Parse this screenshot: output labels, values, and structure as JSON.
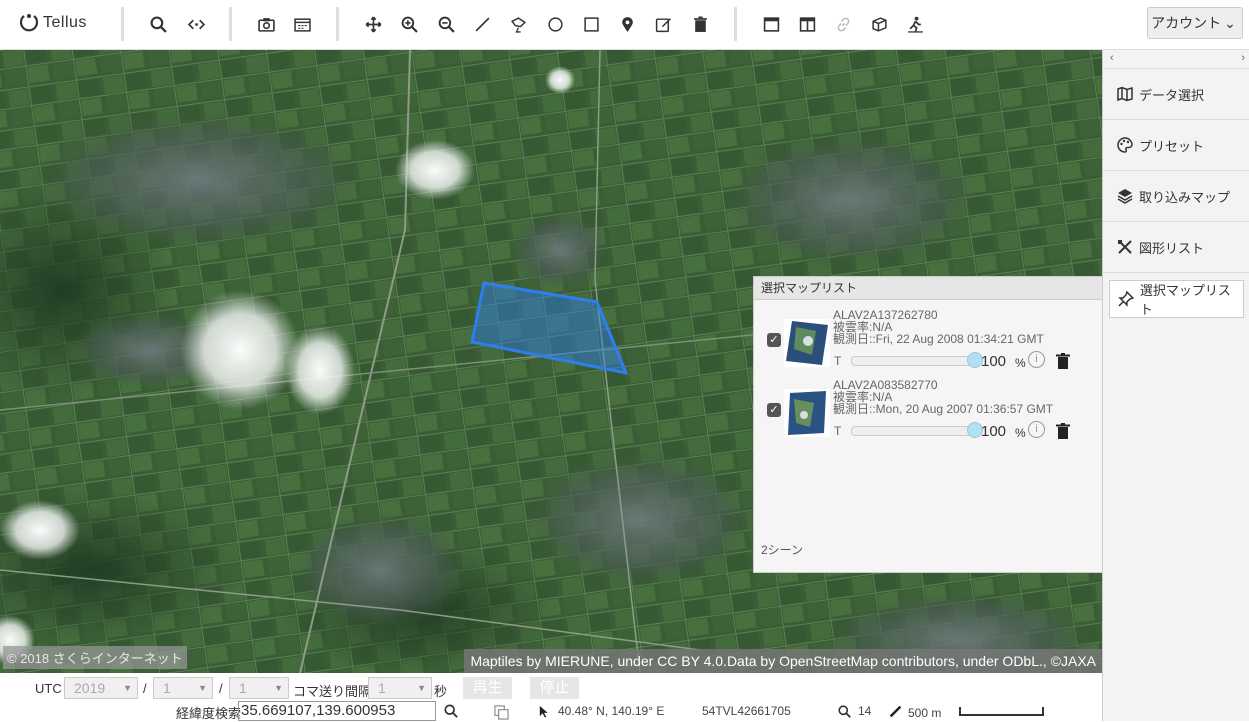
{
  "app": {
    "logo_text": "Tellus"
  },
  "toolbar": {
    "account_label": "アカウント",
    "account_chevron": "⌄",
    "tools": [
      "search-icon",
      "code-icon",
      "camera-icon",
      "calendar-icon",
      "move-icon",
      "zoom-in-icon",
      "zoom-out-icon",
      "line-icon",
      "polygon-icon",
      "circle-icon",
      "square-icon",
      "pin-icon",
      "edit-icon",
      "trash-icon",
      "window-icon",
      "split-icon",
      "link-icon",
      "cube-icon",
      "person-icon"
    ]
  },
  "sidepanel": {
    "nav_left": "‹",
    "nav_right": "›",
    "items": [
      {
        "label": "データ選択",
        "icon": "map-icon"
      },
      {
        "label": "プリセット",
        "icon": "palette-icon"
      },
      {
        "label": "取り込みマップ",
        "icon": "layers-icon"
      },
      {
        "label": "図形リスト",
        "icon": "shapes-icon"
      },
      {
        "label": "選択マップリスト",
        "icon": "pin-list-icon"
      }
    ]
  },
  "map_list": {
    "title": "選択マップリスト",
    "count": "2シーン",
    "items": [
      {
        "id": "ALAV2A137262780",
        "cloud": "被雲率:N/A",
        "date": "観測日::Fri, 22 Aug 2008 01:34:21 GMT",
        "slider_label": "T",
        "opacity": "100",
        "unit": "%",
        "checked": true,
        "check_glyph": "✓",
        "info_glyph": "i"
      },
      {
        "id": "ALAV2A083582770",
        "cloud": "被雲率:N/A",
        "date": "観測日::Mon, 20 Aug 2007 01:36:57 GMT",
        "slider_label": "T",
        "opacity": "100",
        "unit": "%",
        "checked": true,
        "check_glyph": "✓",
        "info_glyph": "i"
      }
    ]
  },
  "map": {
    "copyright": "© 2018 さくらインターネット",
    "attribution": "Maptiles by MIERUNE, under CC BY 4.0.Data by OpenStreetMap contributors, under ODbL., ©JAXA",
    "selection_color": "#2f7ef0"
  },
  "bottom": {
    "utc_label": "UTC",
    "year": "2019",
    "month": "1",
    "day": "1",
    "slash": "/",
    "dropdown_arrow": "▼",
    "interval_label": "コマ送り間隔",
    "interval_value": "1",
    "seconds_label": "秒",
    "play_label": "再生",
    "stop_label": "停止",
    "coord_search_label": "経緯度検索",
    "coord_value": "35.669107,139.600953",
    "cursor_position": "40.48° N, 140.19° E",
    "mgrs": "54TVL42661705",
    "zoom": "14",
    "scale": "500 m"
  }
}
